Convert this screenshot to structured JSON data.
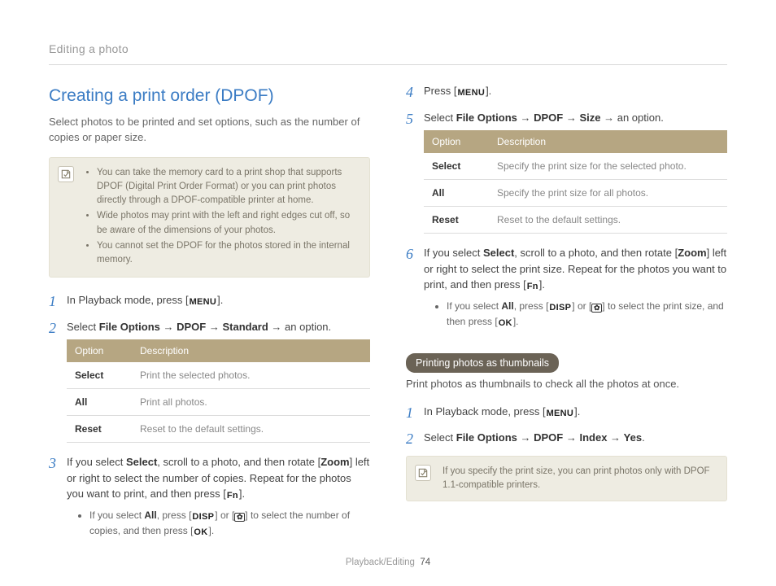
{
  "breadcrumb": "Editing a photo",
  "title": "Creating a print order (DPOF)",
  "subtitle": "Select photos to be printed and set options, such as the number of copies or paper size.",
  "noteA": {
    "items": [
      "You can take the memory card to a print shop that supports DPOF (Digital Print Order Format) or you can print photos directly through a DPOF-compatible printer at home.",
      "Wide photos may print with the left and right edges cut off, so be aware of the dimensions of your photos.",
      "You cannot set the DPOF for the photos stored in the internal memory."
    ]
  },
  "glyph": {
    "menu": "MENU",
    "disp": "DISP",
    "fn": "Fn",
    "ok": "OK"
  },
  "stepsL": {
    "s1_pre": "In Playback mode, press [",
    "s1_post": "].",
    "s2_a": "Select ",
    "s2_b": "File Options",
    "s2_c": " → ",
    "s2_d": "DPOF",
    "s2_e": " → ",
    "s2_f": "Standard",
    "s2_g": " → an option.",
    "s3_a": "If you select ",
    "s3_b": "Select",
    "s3_c": ", scroll to a photo, and then rotate [",
    "s3_d": "Zoom",
    "s3_e": "] left or right to select the number of copies. Repeat for the photos you want to print, and then press [",
    "s3_f": "].",
    "s3_sub_a": "If you select ",
    "s3_sub_b": "All",
    "s3_sub_c": ", press [",
    "s3_sub_d": "] or [",
    "s3_sub_e": "] to select the number of copies, and then press [",
    "s3_sub_f": "]."
  },
  "tableL": {
    "h1": "Option",
    "h2": "Description",
    "rows": [
      {
        "o": "Select",
        "d": "Print the selected photos."
      },
      {
        "o": "All",
        "d": "Print all photos."
      },
      {
        "o": "Reset",
        "d": "Reset to the default settings."
      }
    ]
  },
  "stepsR": {
    "s4_pre": "Press [",
    "s4_post": "].",
    "s5_a": "Select ",
    "s5_b": "File Options",
    "s5_c": " → ",
    "s5_d": "DPOF",
    "s5_e": " → ",
    "s5_f": "Size",
    "s5_g": " → an option.",
    "s6_a": "If you select ",
    "s6_b": "Select",
    "s6_c": ", scroll to a photo, and then rotate [",
    "s6_d": "Zoom",
    "s6_e": "] left or right to select the print size. Repeat for the photos you want to print, and then press [",
    "s6_f": "].",
    "s6_sub_a": "If you select ",
    "s6_sub_b": "All",
    "s6_sub_c": ", press [",
    "s6_sub_d": "] or [",
    "s6_sub_e": "] to select the print size, and then press [",
    "s6_sub_f": "]."
  },
  "tableR": {
    "h1": "Option",
    "h2": "Description",
    "rows": [
      {
        "o": "Select",
        "d": "Specify the print size for the selected photo."
      },
      {
        "o": "All",
        "d": "Specify the print size for all photos."
      },
      {
        "o": "Reset",
        "d": "Reset to the default settings."
      }
    ]
  },
  "pill_title": "Printing photos as thumbnails",
  "pill_desc": "Print photos as thumbnails to check all the photos at once.",
  "stepsT": {
    "s1_pre": "In Playback mode, press [",
    "s1_post": "].",
    "s2_a": "Select ",
    "s2_b": "File Options",
    "s2_c": " → ",
    "s2_d": "DPOF",
    "s2_e": " → ",
    "s2_f": "Index",
    "s2_g": " → ",
    "s2_h": "Yes",
    "s2_i": "."
  },
  "noteB": "If you specify the print size, you can print photos only with DPOF 1.1-compatible printers.",
  "footer": {
    "section": "Playback/Editing",
    "page": "74"
  }
}
